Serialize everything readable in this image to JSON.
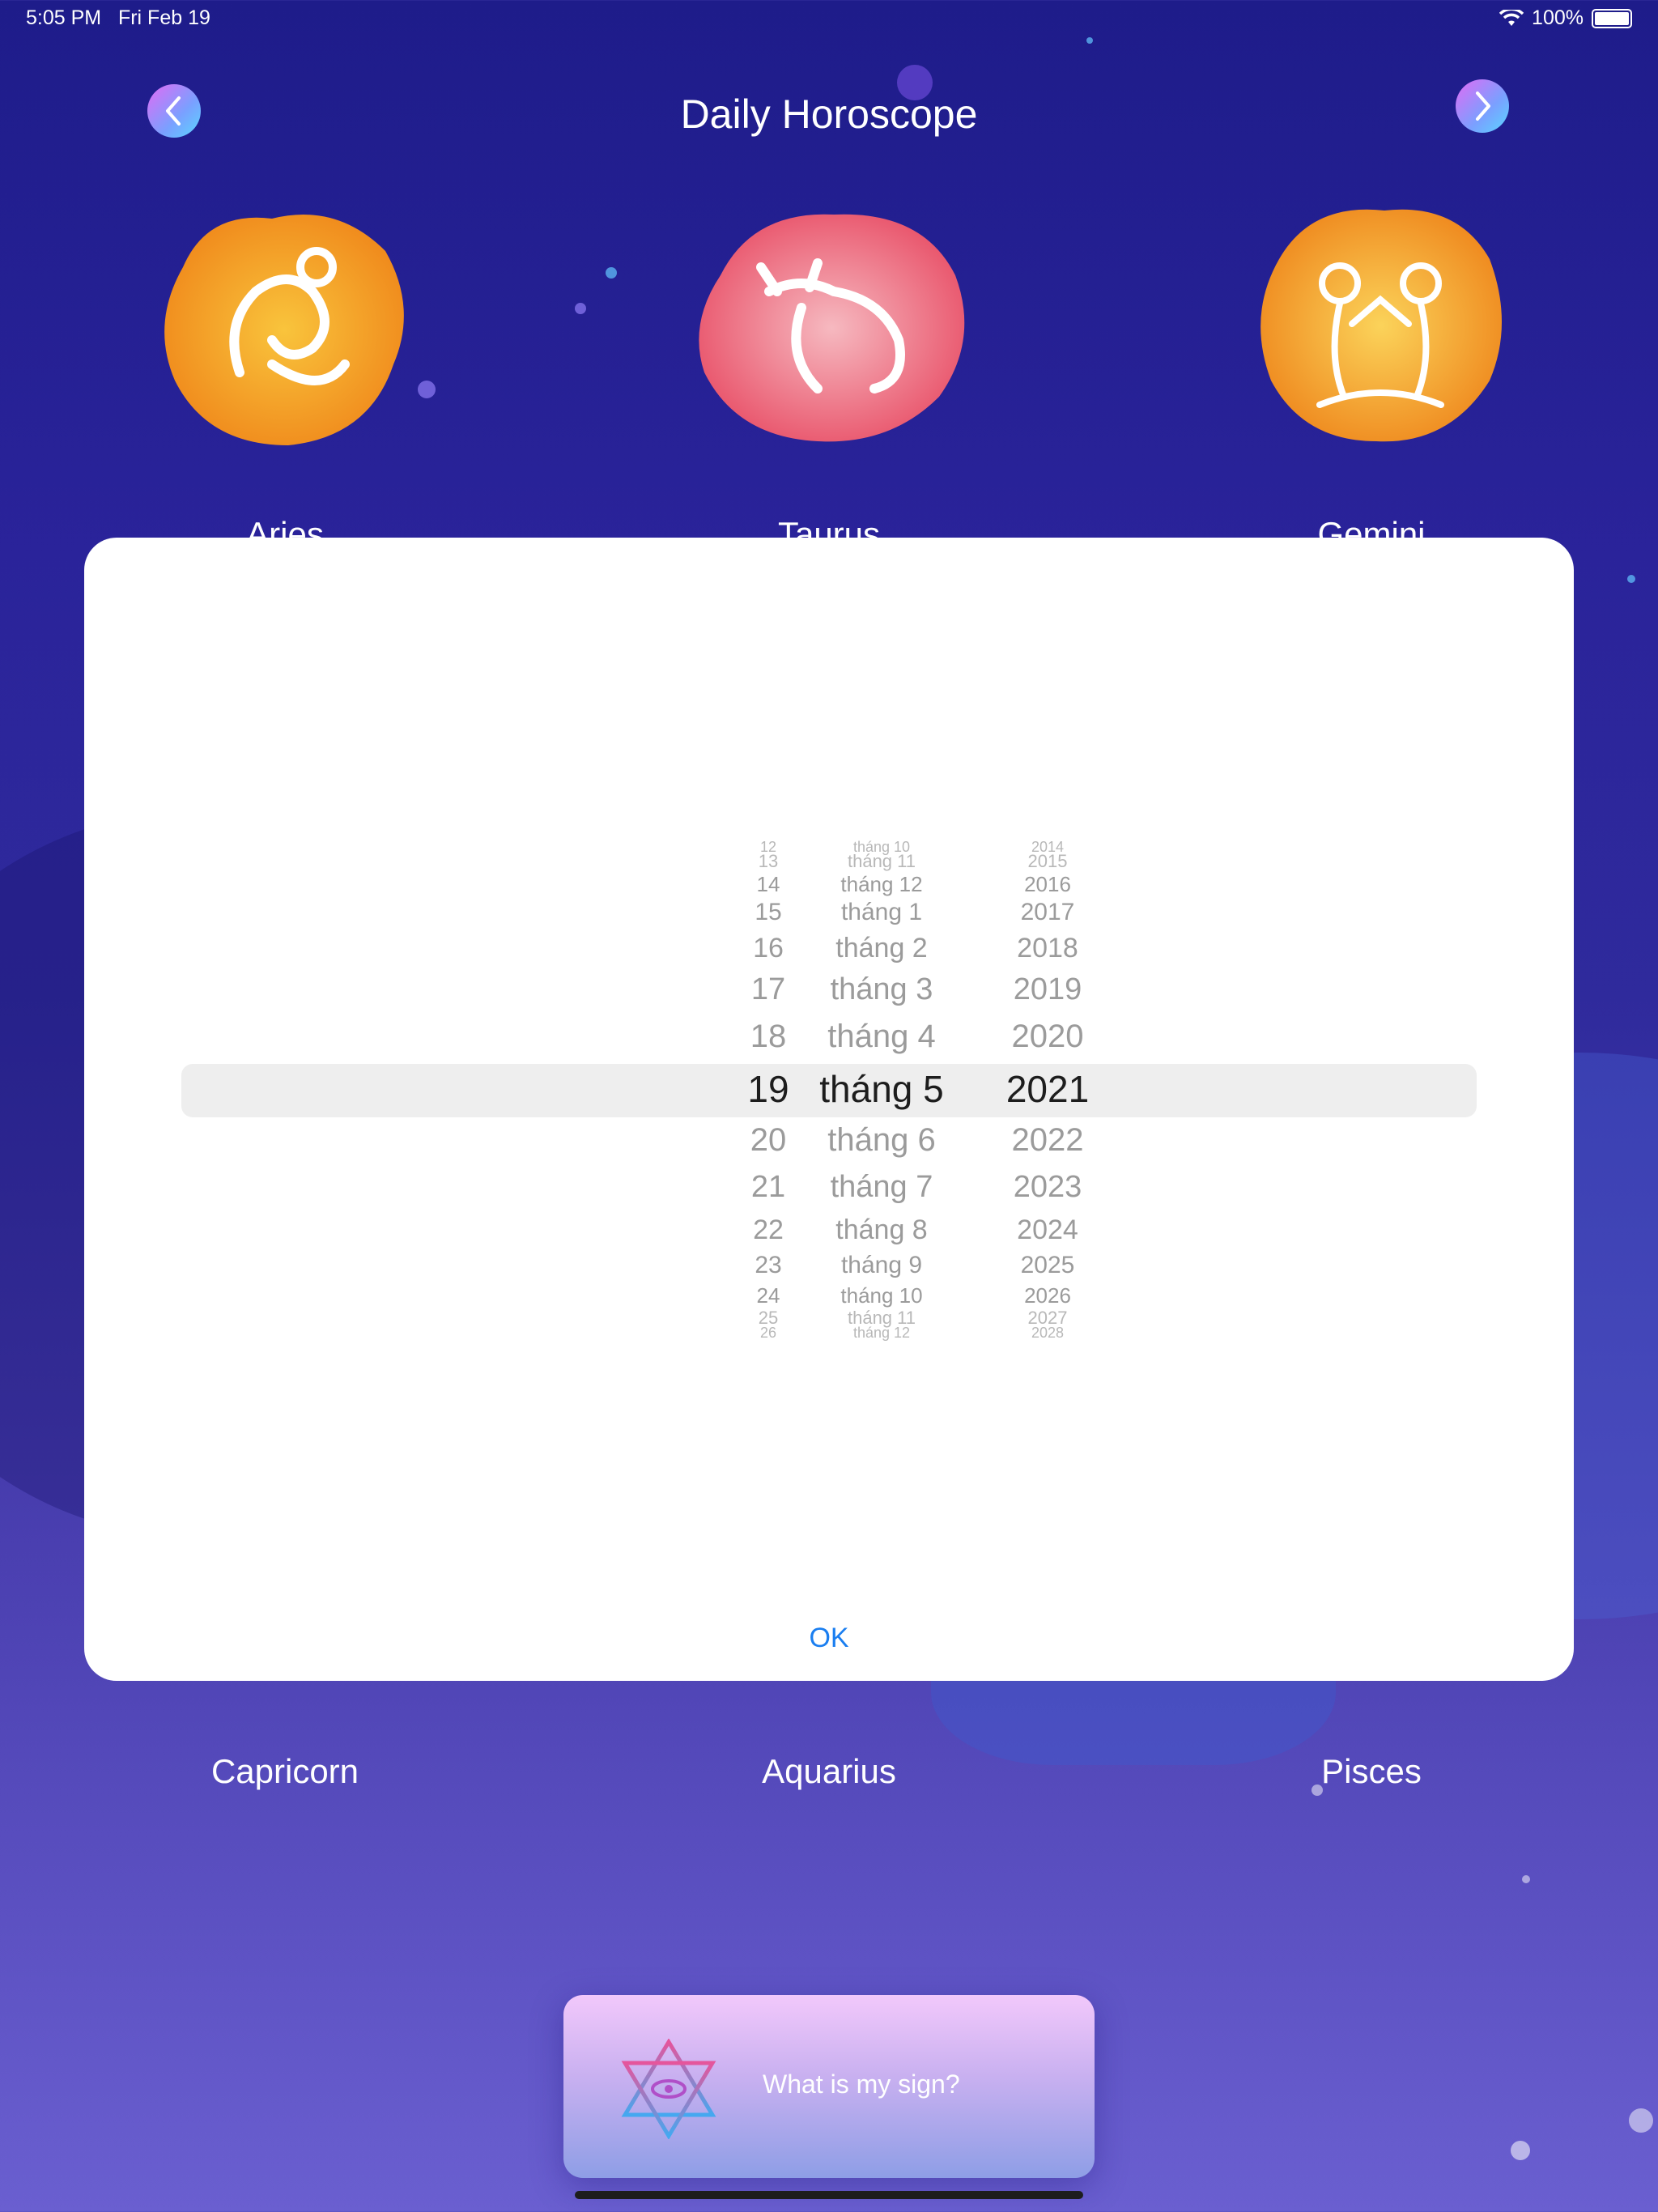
{
  "status": {
    "time": "5:05 PM",
    "date": "Fri Feb 19",
    "battery": "100%"
  },
  "header": {
    "title": "Daily Horoscope"
  },
  "signs_top": [
    {
      "name": "Aries",
      "icon": "aries-icon"
    },
    {
      "name": "Taurus",
      "icon": "taurus-icon"
    },
    {
      "name": "Gemini",
      "icon": "gemini-icon"
    }
  ],
  "signs_bottom": [
    {
      "name": "Capricorn"
    },
    {
      "name": "Aquarius"
    },
    {
      "name": "Pisces"
    }
  ],
  "picker": {
    "days": [
      "12",
      "13",
      "14",
      "15",
      "16",
      "17",
      "18",
      "19",
      "20",
      "21",
      "22",
      "23",
      "24",
      "25",
      "26"
    ],
    "months": [
      "tháng 10",
      "tháng 11",
      "tháng 12",
      "tháng 1",
      "tháng 2",
      "tháng 3",
      "tháng 4",
      "tháng 5",
      "tháng 6",
      "tháng 7",
      "tháng 8",
      "tháng 9",
      "tháng 10",
      "tháng 11",
      "tháng 12"
    ],
    "years": [
      "2014",
      "2015",
      "2016",
      "2017",
      "2018",
      "2019",
      "2020",
      "2021",
      "2022",
      "2023",
      "2024",
      "2025",
      "2026",
      "2027",
      "2028"
    ],
    "selected": {
      "day": "19",
      "month": "tháng 5",
      "year": "2021"
    }
  },
  "modal": {
    "ok_label": "OK"
  },
  "cta": {
    "label": "What is my sign?",
    "icon": "star-of-david-eye-icon"
  }
}
